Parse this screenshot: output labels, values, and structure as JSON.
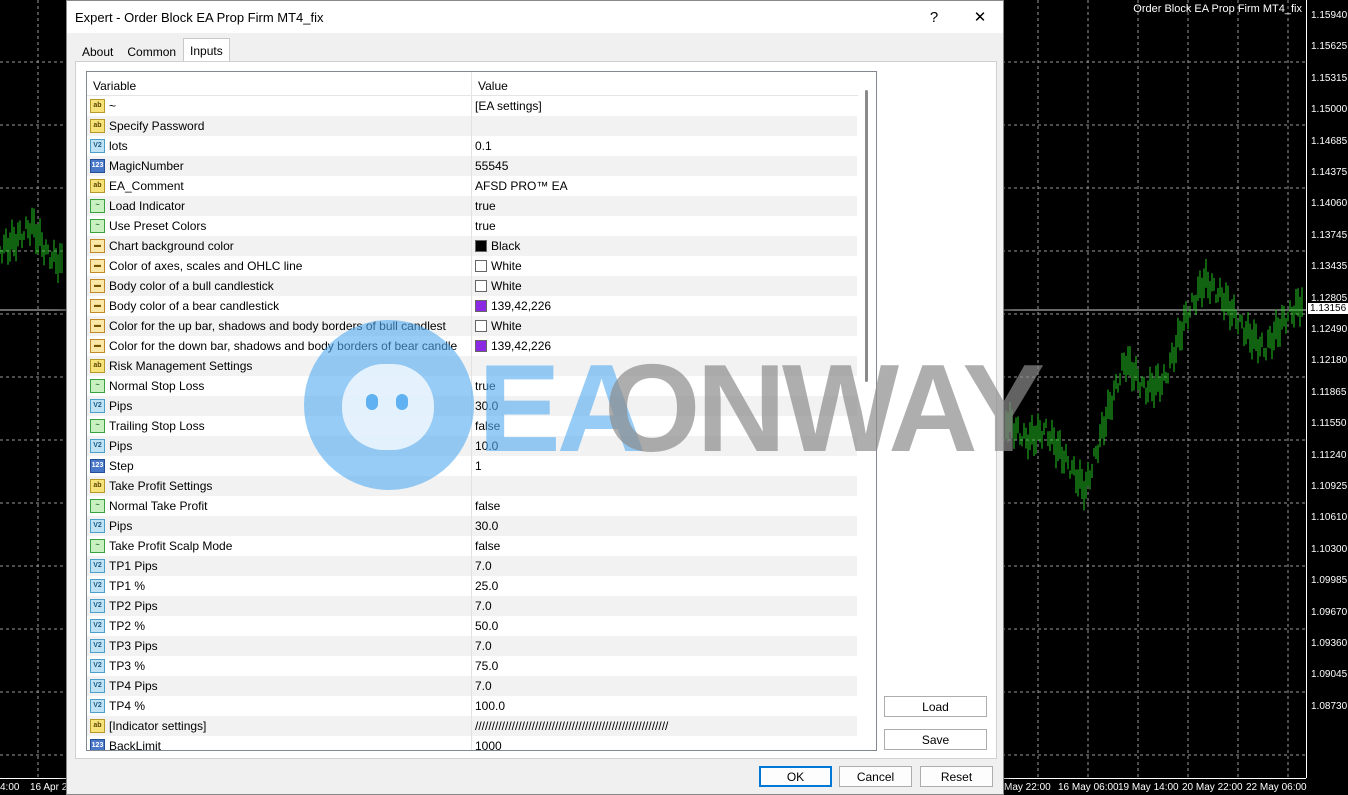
{
  "chart": {
    "title": "Order Block EA Prop Firm MT4_fix",
    "prices": [
      "1.15940",
      "1.15625",
      "1.15315",
      "1.15000",
      "1.14685",
      "1.14375",
      "1.14060",
      "1.13745",
      "1.13435",
      "1.12805",
      "1.12490",
      "1.12180",
      "1.11865",
      "1.11550",
      "1.11240",
      "1.10925",
      "1.10610",
      "1.10300",
      "1.09985",
      "1.09670",
      "1.09360",
      "1.09045",
      "1.08730"
    ],
    "current_price": "1.13156",
    "times": [
      "4:00",
      "16 Apr 2",
      "May 22:00",
      "16 May 06:00",
      "19 May 14:00",
      "20 May 22:00",
      "22 May 06:00"
    ],
    "candle_color": "#22c322"
  },
  "dialog": {
    "title": "Expert - Order Block EA Prop Firm MT4_fix",
    "help": "?",
    "close": "✕",
    "tabs": [
      "About",
      "Common",
      "Inputs"
    ],
    "grid": {
      "col_variable": "Variable",
      "col_value": "Value",
      "rows": [
        {
          "icon": "ab",
          "name": "~",
          "value": "[EA settings]"
        },
        {
          "icon": "ab",
          "name": "Specify Password",
          "value": ""
        },
        {
          "icon": "v2",
          "name": "lots",
          "value": "0.1"
        },
        {
          "icon": "n123",
          "name": "MagicNumber",
          "value": "55545"
        },
        {
          "icon": "ab",
          "name": "EA_Comment",
          "value": "AFSD PRO™ EA"
        },
        {
          "icon": "bool",
          "name": "Load Indicator",
          "value": "true"
        },
        {
          "icon": "bool",
          "name": "Use Preset Colors",
          "value": "true"
        },
        {
          "icon": "col",
          "name": "Chart background color",
          "value": "Black",
          "swatch": "#000000"
        },
        {
          "icon": "col",
          "name": "Color of axes, scales and OHLC line",
          "value": "White",
          "swatch": "#ffffff"
        },
        {
          "icon": "col",
          "name": "Body color of a bull candlestick",
          "value": "White",
          "swatch": "#ffffff"
        },
        {
          "icon": "col",
          "name": "Body color of a bear candlestick",
          "value": "139,42,226",
          "swatch": "#8b2ae2"
        },
        {
          "icon": "col",
          "name": "Color for the up bar, shadows and body borders of bull candlest",
          "value": "White",
          "swatch": "#ffffff"
        },
        {
          "icon": "col",
          "name": "Color for the down bar, shadows and body borders of bear candle",
          "value": "139,42,226",
          "swatch": "#8b2ae2"
        },
        {
          "icon": "ab",
          "name": "Risk Management Settings",
          "value": ""
        },
        {
          "icon": "bool",
          "name": "Normal Stop Loss",
          "value": "true"
        },
        {
          "icon": "v2",
          "name": "Pips",
          "value": "30.0"
        },
        {
          "icon": "bool",
          "name": "Trailing Stop Loss",
          "value": "false"
        },
        {
          "icon": "v2",
          "name": "Pips",
          "value": "10.0"
        },
        {
          "icon": "n123",
          "name": "Step",
          "value": "1"
        },
        {
          "icon": "ab",
          "name": "Take Profit Settings",
          "value": ""
        },
        {
          "icon": "bool",
          "name": "Normal Take Profit",
          "value": "false"
        },
        {
          "icon": "v2",
          "name": "Pips",
          "value": "30.0"
        },
        {
          "icon": "bool",
          "name": "Take Profit Scalp Mode",
          "value": "false"
        },
        {
          "icon": "v2",
          "name": "TP1 Pips",
          "value": "7.0"
        },
        {
          "icon": "v2",
          "name": "TP1 %",
          "value": "25.0"
        },
        {
          "icon": "v2",
          "name": "TP2 Pips",
          "value": "7.0"
        },
        {
          "icon": "v2",
          "name": "TP2 %",
          "value": "50.0"
        },
        {
          "icon": "v2",
          "name": "TP3 Pips",
          "value": "7.0"
        },
        {
          "icon": "v2",
          "name": "TP3 %",
          "value": "75.0"
        },
        {
          "icon": "v2",
          "name": "TP4 Pips",
          "value": "7.0"
        },
        {
          "icon": "v2",
          "name": "TP4 %",
          "value": "100.0"
        },
        {
          "icon": "ab",
          "name": "[Indicator settings]",
          "value": "//////////////////////////////////////////////////////////"
        },
        {
          "icon": "n123",
          "name": "BackLimit",
          "value": "1000"
        }
      ]
    },
    "buttons": {
      "load": "Load",
      "save": "Save",
      "ok": "OK",
      "cancel": "Cancel",
      "reset": "Reset"
    }
  },
  "watermark": {
    "part1": "EA",
    "part2": "ONWAY"
  },
  "icon_labels": {
    "ab": "ab",
    "v2": "V2",
    "n123": "123",
    "bool": "~",
    "col": "▬"
  }
}
